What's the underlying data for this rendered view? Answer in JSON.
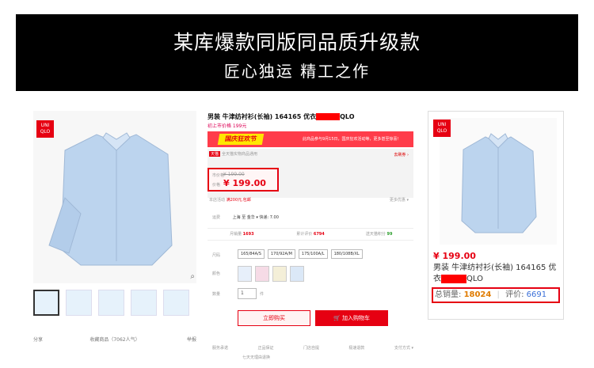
{
  "banner": {
    "title": "某库爆款同版同品质升级款",
    "subtitle": "匠心独运 精工之作"
  },
  "left": {
    "brand_badge": "UNI QLO",
    "thumbs": 5,
    "share": "分享",
    "favorite": "收藏商品（7062人气）",
    "report": "举报"
  },
  "center": {
    "title_prefix": "男装 牛津纺衬衫(长袖) 164165 优衣",
    "title_suffix": "QLO",
    "subtitle": "初上市价格 199元",
    "promo_badge": "国庆狂欢节",
    "promo_text": "此商品参与9月15日，国庆狂欢活动等，更多甚至惊喜！",
    "tmall_tag": "天猫",
    "tmall_text": "全天猫实物商品通用",
    "more_link": "去刷券 ›",
    "orig_label": "市价格",
    "orig_price": "¥ 199.00",
    "now_label": "价格",
    "now_price": "¥ 199.00",
    "benefit_label": "本店活动",
    "benefit_value": "满200元,包邮",
    "more_benefit": "更多优惠 ▾",
    "ship_label": "运费",
    "ship_value": "上海 至 金华 ▾ 快递: 7.00",
    "stats": [
      {
        "label": "月销量",
        "value": "1693"
      },
      {
        "label": "累计评价",
        "value": "6794"
      },
      {
        "label": "送天猫积分",
        "value": "99"
      }
    ],
    "size_label": "尺码",
    "sizes": [
      "165/84A/S",
      "170/92A/M",
      "175/100A/L",
      "180/108B/XL"
    ],
    "color_label": "颜色",
    "colors": [
      "#e7effa",
      "#f6dbe6",
      "#f4efd8",
      "#dbe8f7"
    ],
    "qty_label": "数量",
    "qty_value": "1",
    "qty_unit": "件",
    "buy_now": "立即购买",
    "add_cart": "加入购物车",
    "footer": [
      "服务承诺",
      "正品保证",
      "门店自提",
      "极速退款",
      "支付方式 ▾"
    ],
    "footer_extra": "七天无理由退换"
  },
  "right": {
    "price": "¥ 199.00",
    "title_prefix": "男装 牛津纺衬衫(长袖) 164165 优衣",
    "title_suffix": "QLO",
    "sales_label": "总销量:",
    "sales_value": "18024",
    "review_label": "评价:",
    "review_value": "6691"
  }
}
